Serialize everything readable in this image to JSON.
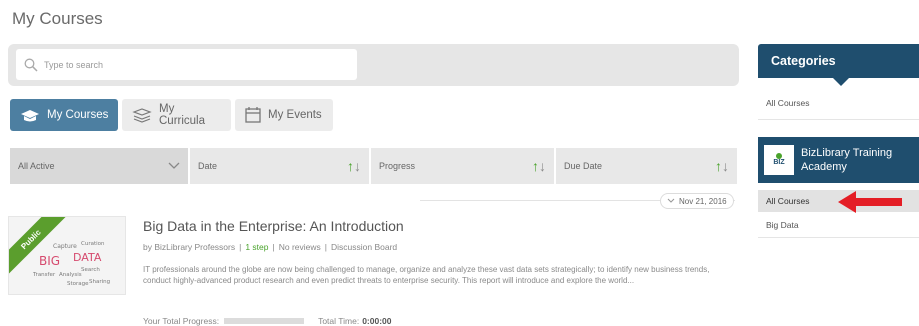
{
  "page": {
    "title": "My Courses"
  },
  "search": {
    "placeholder": "Type to search",
    "value": ""
  },
  "tabs": [
    {
      "label": "My Courses",
      "icon": "courses-icon",
      "active": true
    },
    {
      "label": "My Curricula",
      "icon": "curricula-icon",
      "active": false
    },
    {
      "label": "My Events",
      "icon": "calendar-icon",
      "active": false
    }
  ],
  "filters": {
    "status": "All Active",
    "date": "Date",
    "progress": "Progress",
    "due_date": "Due Date"
  },
  "date_group": {
    "label": "Nov 21, 2016"
  },
  "course": {
    "badge": "Public",
    "title": "Big Data in the Enterprise: An Introduction",
    "author": "by BizLibrary Professors",
    "steps": "1 step",
    "reviews": "No reviews",
    "board": "Discussion Board",
    "description": "IT professionals around the globe are now being challenged to manage, organize and analyze these vast data sets strategically; to identify new business trends, conduct highly-advanced product research and even predict threats to enterprise security. This report will introduce and explore the world...",
    "progress_label": "Your Total Progress:",
    "progress_value": 0,
    "time_label": "Total Time:",
    "time_value": "0:00:00",
    "thumb_words": [
      "BIG",
      "DATA",
      "Capture",
      "Curation",
      "Search",
      "Analysis",
      "Transfer",
      "Storage",
      "Sharing"
    ]
  },
  "sidebar": {
    "categories_title": "Categories",
    "all_courses": "All Courses",
    "academy_logo": "BIZ",
    "academy_name": "BizLibrary Training Academy",
    "academy_items": [
      "All Courses",
      "Big Data"
    ]
  },
  "colors": {
    "accent": "#4d7fa1",
    "sidebar_header": "#1f4e6e",
    "green": "#4aa32c",
    "arrow": "#e41e26"
  }
}
